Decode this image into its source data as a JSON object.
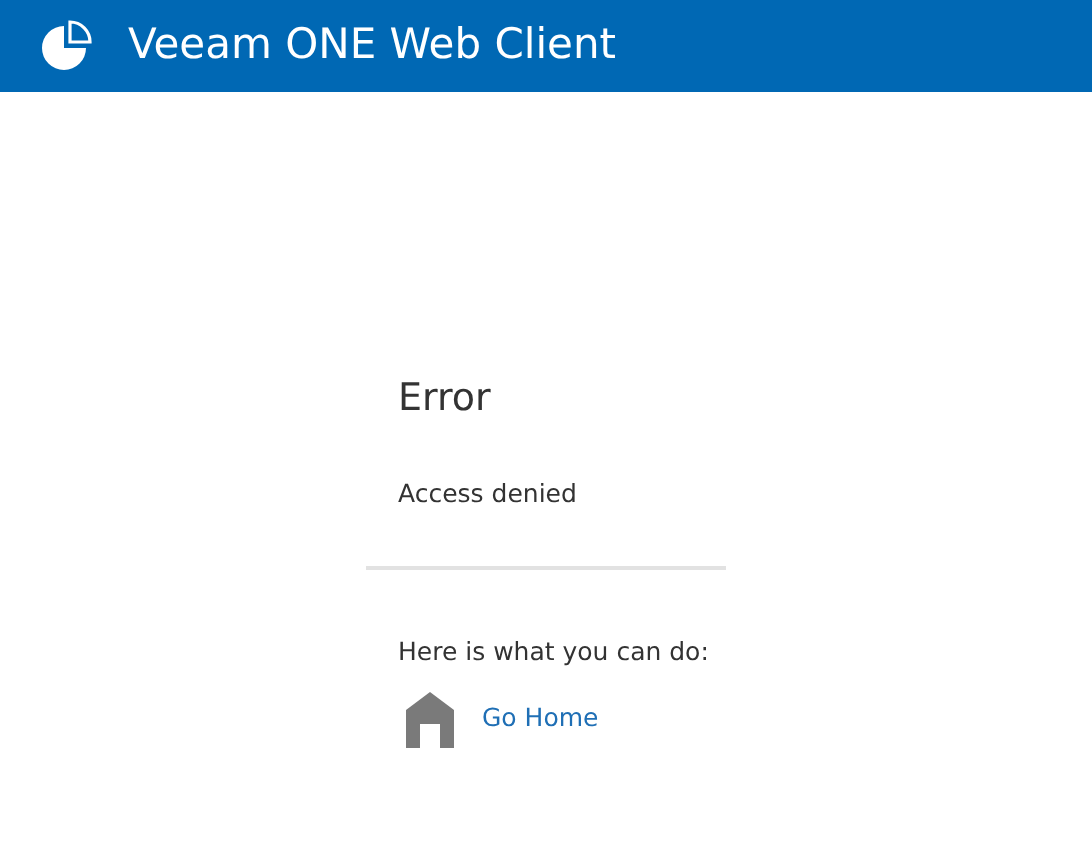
{
  "header": {
    "title": "Veeam ONE Web Client"
  },
  "error": {
    "title": "Error",
    "message": "Access denied",
    "hint": "Here is what you can do:"
  },
  "actions": [
    {
      "label": "Go Home"
    }
  ]
}
